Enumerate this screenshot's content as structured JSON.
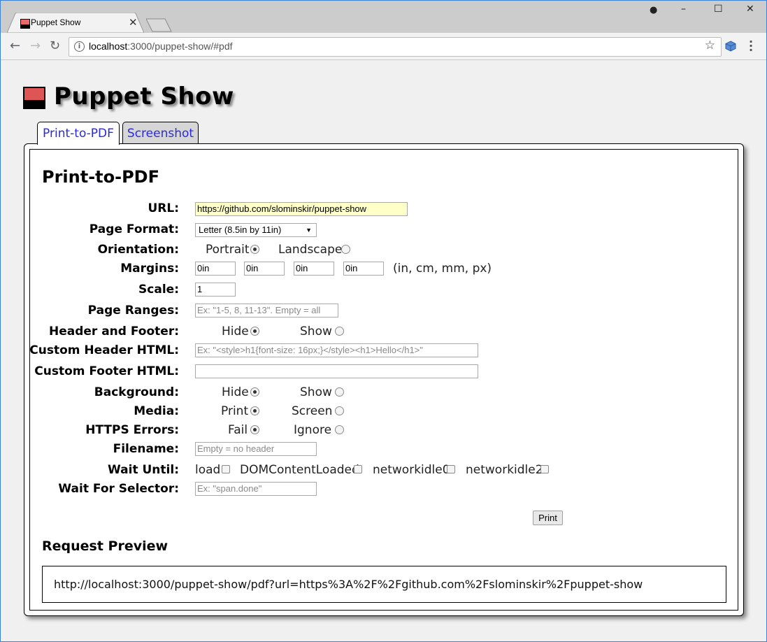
{
  "browser": {
    "tab_title": "Puppet Show",
    "url_host": "localhost",
    "url_rest": ":3000/puppet-show/#pdf"
  },
  "app": {
    "title": "Puppet Show",
    "tabs": [
      "Print-to-PDF",
      "Screenshot"
    ],
    "active_tab": "Print-to-PDF"
  },
  "form": {
    "heading": "Print-to-PDF",
    "url": {
      "label": "URL:",
      "value": "https://github.com/slominskir/puppet-show"
    },
    "page_format": {
      "label": "Page Format:",
      "value": "Letter (8.5in by 11in)"
    },
    "orientation": {
      "label": "Orientation:",
      "options": [
        "Portrait",
        "Landscape"
      ],
      "selected": "Portrait"
    },
    "margins": {
      "label": "Margins:",
      "values": [
        "0in",
        "0in",
        "0in",
        "0in"
      ],
      "hint": "(in, cm, mm, px)"
    },
    "scale": {
      "label": "Scale:",
      "value": "1"
    },
    "page_ranges": {
      "label": "Page Ranges:",
      "placeholder": "Ex: \"1-5, 8, 11-13\". Empty = all"
    },
    "header_footer": {
      "label": "Header and Footer:",
      "options": [
        "Hide",
        "Show"
      ],
      "selected": "Hide"
    },
    "custom_header": {
      "label": "Custom Header HTML:",
      "placeholder": "Ex: \"<style>h1{font-size: 16px;}</style><h1>Hello</h1>\""
    },
    "custom_footer": {
      "label": "Custom Footer HTML:",
      "value": ""
    },
    "background": {
      "label": "Background:",
      "options": [
        "Hide",
        "Show"
      ],
      "selected": "Hide"
    },
    "media": {
      "label": "Media:",
      "options": [
        "Print",
        "Screen"
      ],
      "selected": "Print"
    },
    "https_errors": {
      "label": "HTTPS Errors:",
      "options": [
        "Fail",
        "Ignore"
      ],
      "selected": "Fail"
    },
    "filename": {
      "label": "Filename:",
      "placeholder": "Empty = no header"
    },
    "wait_until": {
      "label": "Wait Until:",
      "options": [
        "load",
        "DOMContentLoaded",
        "networkidle0",
        "networkidle2"
      ]
    },
    "wait_for_selector": {
      "label": "Wait For Selector:",
      "placeholder": "Ex: \"span.done\""
    },
    "print_button": "Print"
  },
  "preview": {
    "heading": "Request Preview",
    "text": "http://localhost:3000/puppet-show/pdf?url=https%3A%2F%2Fgithub.com%2Fslominskir%2Fpuppet-show"
  }
}
